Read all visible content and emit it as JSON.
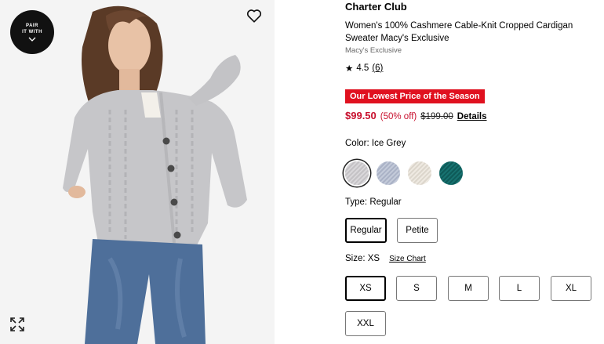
{
  "gallery": {
    "pair_badge_line1": "PAIR",
    "pair_badge_line2": "IT WITH",
    "icons": {
      "favorite": "heart-outline-icon",
      "expand": "expand-arrows-icon",
      "pair_toggle": "chevron-down-icon"
    }
  },
  "product": {
    "brand": "Charter Club",
    "title": "Women's 100% Cashmere Cable-Knit Cropped Cardigan Sweater Macy's Exclusive",
    "exclusive_tag": "Macy's Exclusive",
    "rating": {
      "star": "★",
      "value": "4.5",
      "count": "(6)"
    },
    "promo_badge": "Our Lowest Price of the Season",
    "price": {
      "sale": "$99.50",
      "discount": "(50% off)",
      "original": "$199.00",
      "details_link": "Details"
    },
    "accent_color": "#e0111f"
  },
  "color": {
    "label": "Color: Ice Grey",
    "options": [
      {
        "name": "Ice Grey",
        "hex": "#cfcdd0",
        "selected": true
      },
      {
        "name": "Light Blue",
        "hex": "#b8bfd0",
        "selected": false
      },
      {
        "name": "Ivory",
        "hex": "#e6e0d7",
        "selected": false
      },
      {
        "name": "Teal",
        "hex": "#136664",
        "selected": false
      }
    ]
  },
  "type": {
    "label": "Type: Regular",
    "options": [
      "Regular",
      "Petite"
    ],
    "selected": "Regular"
  },
  "size": {
    "label": "Size: XS",
    "size_chart_link": "Size Chart",
    "options": [
      "XS",
      "S",
      "M",
      "L",
      "XL",
      "XXL"
    ],
    "selected": "XS"
  }
}
